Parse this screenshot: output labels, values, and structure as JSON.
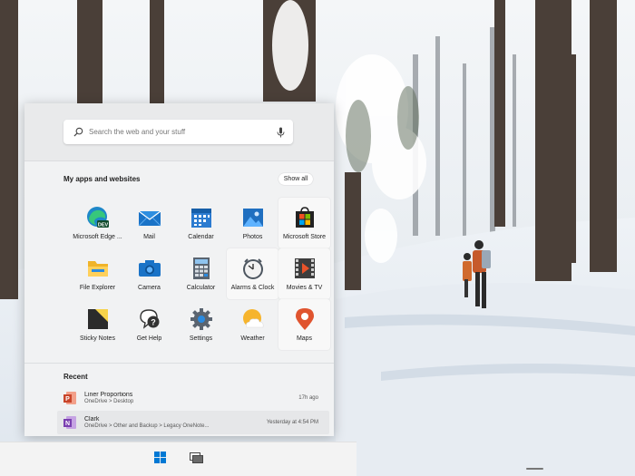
{
  "search": {
    "placeholder": "Search the web and your stuff",
    "icon": "search-icon",
    "mic_icon": "microphone-icon"
  },
  "apps": {
    "header": "My apps and websites",
    "show_all_label": "Show all",
    "items": [
      {
        "label": "Microsoft Edge ...",
        "icon": "edge-dev-icon"
      },
      {
        "label": "Mail",
        "icon": "mail-icon"
      },
      {
        "label": "Calendar",
        "icon": "calendar-icon"
      },
      {
        "label": "Photos",
        "icon": "photos-icon"
      },
      {
        "label": "Microsoft Store",
        "icon": "store-icon"
      },
      {
        "label": "File Explorer",
        "icon": "folder-icon"
      },
      {
        "label": "Camera",
        "icon": "camera-icon"
      },
      {
        "label": "Calculator",
        "icon": "calculator-icon"
      },
      {
        "label": "Alarms & Clock",
        "icon": "clock-icon"
      },
      {
        "label": "Movies & TV",
        "icon": "film-icon"
      },
      {
        "label": "Sticky Notes",
        "icon": "sticky-note-icon"
      },
      {
        "label": "Get Help",
        "icon": "help-icon"
      },
      {
        "label": "Settings",
        "icon": "gear-icon"
      },
      {
        "label": "Weather",
        "icon": "weather-icon"
      },
      {
        "label": "Maps",
        "icon": "map-pin-icon"
      }
    ]
  },
  "recent": {
    "header": "Recent",
    "items": [
      {
        "name": "Liner Proportions",
        "path": "OneDrive > Desktop",
        "time": "17h ago",
        "icon": "powerpoint-icon"
      },
      {
        "name": "Clark",
        "path": "OneDrive > Other and Backup > Legacy OneNote...",
        "time": "Yesterday at 4:54 PM",
        "icon": "onenote-icon"
      }
    ]
  },
  "taskbar": {
    "start_icon": "windows-logo-icon",
    "task_view_icon": "task-view-icon"
  },
  "colors": {
    "start_bg": "#f1f2f3",
    "taskbar_bg": "#f3f3f3",
    "accent_blue": "#0078d4"
  }
}
